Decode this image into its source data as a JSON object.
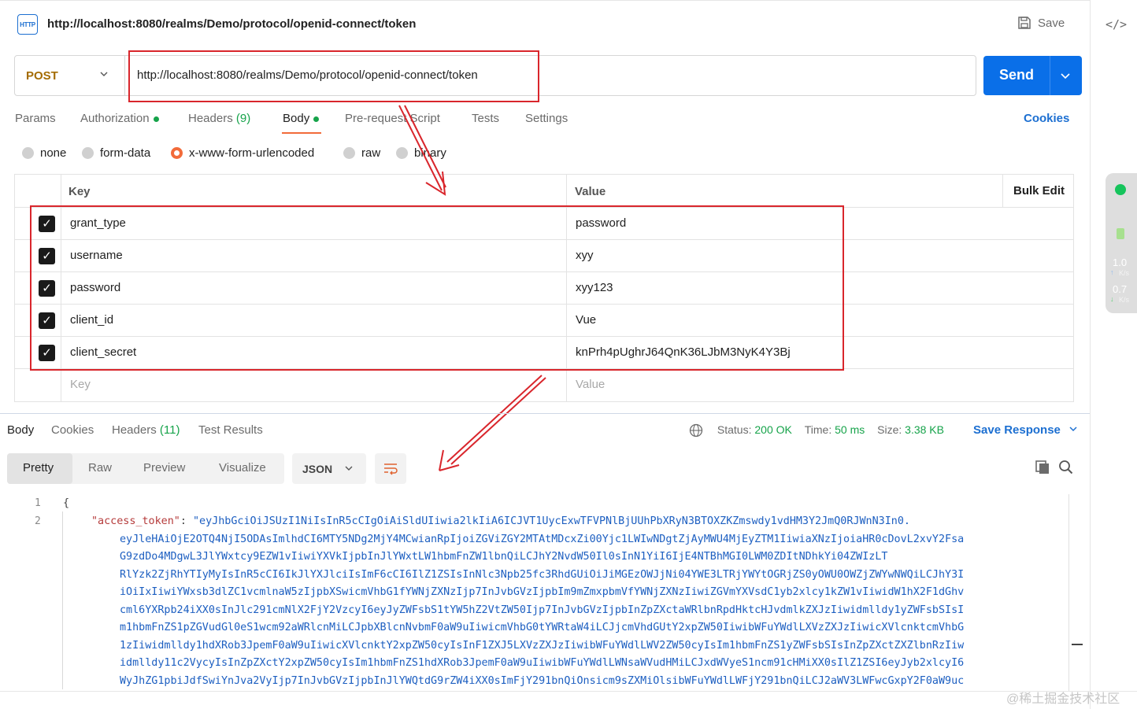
{
  "request": {
    "title": "http://localhost:8080/realms/Demo/protocol/openid-connect/token",
    "save_label": "Save",
    "method": "POST",
    "url": "http://localhost:8080/realms/Demo/protocol/openid-connect/token",
    "send_label": "Send"
  },
  "tabs": {
    "params": "Params",
    "authorization": "Authorization",
    "headers": "Headers",
    "headers_count": "(9)",
    "body": "Body",
    "prerequest": "Pre-request Script",
    "tests": "Tests",
    "settings": "Settings",
    "cookies": "Cookies"
  },
  "body_modes": {
    "none": "none",
    "form_data": "form-data",
    "urlencoded": "x-www-form-urlencoded",
    "raw": "raw",
    "binary": "binary",
    "selected": "x-www-form-urlencoded"
  },
  "params_table": {
    "key_header": "Key",
    "value_header": "Value",
    "bulk_edit": "Bulk Edit",
    "rows": [
      {
        "key": "grant_type",
        "value": "password",
        "checked": true
      },
      {
        "key": "username",
        "value": "xyy",
        "checked": true
      },
      {
        "key": "password",
        "value": "xyy123",
        "checked": true
      },
      {
        "key": "client_id",
        "value": "Vue",
        "checked": true
      },
      {
        "key": "client_secret",
        "value": "knPrh4pUghrJ64QnK36LJbM3NyK4Y3Bj",
        "checked": true
      }
    ],
    "key_placeholder": "Key",
    "value_placeholder": "Value"
  },
  "response": {
    "tabs": {
      "body": "Body",
      "cookies": "Cookies",
      "headers": "Headers",
      "headers_count": "(11)",
      "test_results": "Test Results"
    },
    "status_label": "Status:",
    "status_value": "200 OK",
    "time_label": "Time:",
    "time_value": "50 ms",
    "size_label": "Size:",
    "size_value": "3.38 KB",
    "save_response": "Save Response",
    "formats": {
      "pretty": "Pretty",
      "raw": "Raw",
      "preview": "Preview",
      "visualize": "Visualize"
    },
    "language": "JSON",
    "line_numbers": [
      "1",
      "2"
    ],
    "brace": "{",
    "json_key": "\"access_token\"",
    "colon": ": ",
    "token_lines": [
      "\"eyJhbGciOiJSUzI1NiIsInR5cCIgOiAiSldUIiwia2lkIiA6ICJVT1UycExwTFVPNlBjUUhPbXRyN3BTOXZKZmswdy1vdHM3Y2JmQ0RJWnN3In0.",
      "eyJleHAiOjE2OTQ4NjI5ODAsImlhdCI6MTY5NDg2MjY4MCwianRpIjoiZGViZGY2MTAtMDcxZi00Yjc1LWIwNDgtZjAyMWU4MjEyZTM1IiwiaXNzIjoiaHR0cDovL2xvY2Fsa",
      "G9zdDo4MDgwL3JlYWxtcy9EZW1vIiwiYXVkIjpbInJlYWxtLW1hbmFnZW1lbnQiLCJhY2NvdW50Il0sInN1YiI6IjE4NTBhMGI0LWM0ZDItNDhkYi04ZWIzLT",
      "RlYzk2ZjRhYTIyMyIsInR5cCI6IkJlYXJlciIsImF6cCI6IlZ1ZSIsInNlc3Npb25fc3RhdGUiOiJiMGEzOWJjNi04YWE3LTRjYWYtOGRjZS0yOWU0OWZjZWYwNWQiLCJhY3I",
      "iOiIxIiwiYWxsb3dlZC1vcmlnaW5zIjpbXSwicmVhbG1fYWNjZXNzIjp7InJvbGVzIjpbIm9mZmxpbmVfYWNjZXNzIiwiZGVmYXVsdC1yb2xlcy1kZW1vIiwidW1hX2F1dGhv",
      "cml6YXRpb24iXX0sInJlc291cmNlX2FjY2VzcyI6eyJyZWFsbS1tYW5hZ2VtZW50Ijp7InJvbGVzIjpbInZpZXctaWRlbnRpdHktcHJvdmlkZXJzIiwidmlldy1yZWFsbSIsI",
      "m1hbmFnZS1pZGVudGl0eS1wcm92aWRlcnMiLCJpbXBlcnNvbmF0aW9uIiwicmVhbG0tYWRtaW4iLCJjcmVhdGUtY2xpZW50IiwibWFuYWdlLXVzZXJzIiwicXVlcnktcmVhbG",
      "1zIiwidmlldy1hdXRob3JpemF0aW9uIiwicXVlcnktY2xpZW50cyIsInF1ZXJ5LXVzZXJzIiwibWFuYWdlLWV2ZW50cyIsIm1hbmFnZS1yZWFsbSIsInZpZXctZXZlbnRzIiw",
      "idmlldy11c2VycyIsInZpZXctY2xpZW50cyIsIm1hbmFnZS1hdXRob3JpemF0aW9uIiwibWFuYWdlLWNsaWVudHMiLCJxdWVyeS1ncm91cHMiXX0sIlZ1ZSI6eyJyb2xlcyI6",
      "WyJhZG1pbiJdfSwiYnJva2VyIjp7InJvbGVzIjpbInJlYWQtdG9rZW4iXX0sImFjY291bnQiOnsicm9sZXMiOlsibWFuYWdlLWFjY291bnQiLCJ2aWV3LWFwcGxpY2F0aW9uc"
    ]
  },
  "widget": {
    "up_value": "1.0",
    "up_unit": "K/s",
    "down_value": "0.7",
    "down_unit": "K/s"
  },
  "watermark": "@稀土掘金技术社区",
  "colors": {
    "accent": "#f26b3a",
    "send": "#0a6fe8",
    "link": "#1c6fd1",
    "annotation": "#d9262c",
    "success": "#16a34a"
  }
}
